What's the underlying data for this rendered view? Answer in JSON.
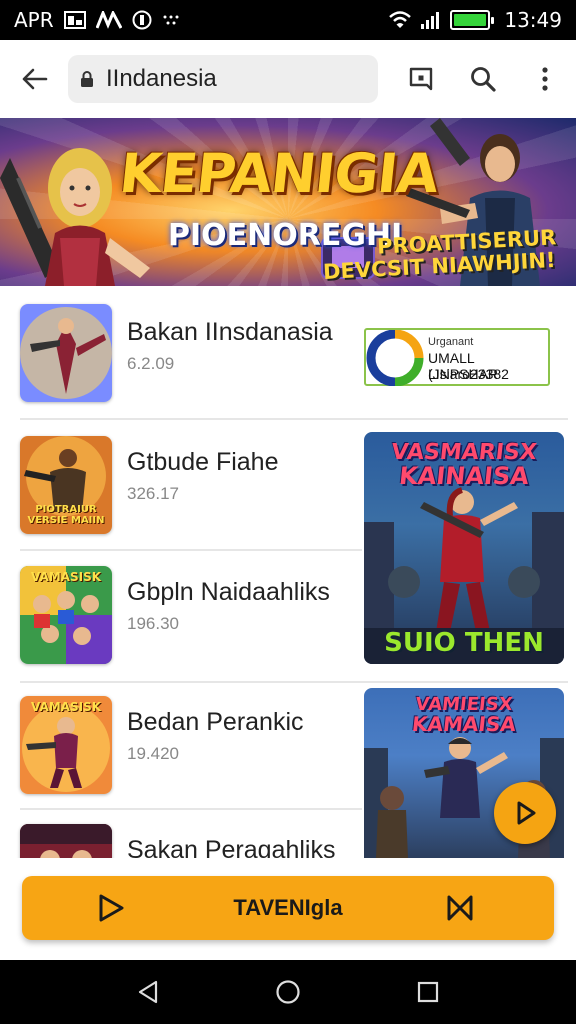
{
  "status_bar": {
    "carrier": "APR",
    "time": "13:49",
    "battery_color": "#35d43a"
  },
  "toolbar": {
    "search_query": "IIndanesia",
    "icons": [
      "back-arrow-icon",
      "lock-icon",
      "share-box-icon",
      "search-icon",
      "more-vert-icon"
    ]
  },
  "banner": {
    "title": "KEPANIGIA",
    "subtitle": "PIOENOREGHI",
    "tag_line1": "PROATTISERUR",
    "tag_line2": "DEVCSIT NIAWHJIN!"
  },
  "apps": [
    {
      "name": "Bakan IInsdanasia",
      "version": "6.2.09"
    },
    {
      "name": "Gtbude Fiahe",
      "version": "326.17"
    },
    {
      "name": "Gbpln Naidaahliks",
      "version": "196.30"
    },
    {
      "name": "Bedan Perankic",
      "version": "19.420"
    },
    {
      "name": "Sakan Peragahliks",
      "version": ""
    }
  ],
  "icon_texts": {
    "app2": "PIOTRAIUR VERSIE MAIIN",
    "app3": "VAMASISK",
    "app4": "VAMASISK"
  },
  "ad_card": {
    "line1": "Urganant",
    "line2": "UMALL LINPSHAR",
    "line3": "(Jsiaro23382"
  },
  "promo1": {
    "title1": "VASMARISX",
    "title2": "KAINAISA",
    "cta": "SUIO THEN"
  },
  "promo2": {
    "title1": "VAMIEISX",
    "title2": "KAMAISA"
  },
  "action_button": {
    "label": "TAVENIgla"
  },
  "colors": {
    "accent": "#f7a514",
    "fab": "#f5a412"
  },
  "nav": [
    "back-triangle-icon",
    "home-circle-icon",
    "recents-square-icon"
  ]
}
